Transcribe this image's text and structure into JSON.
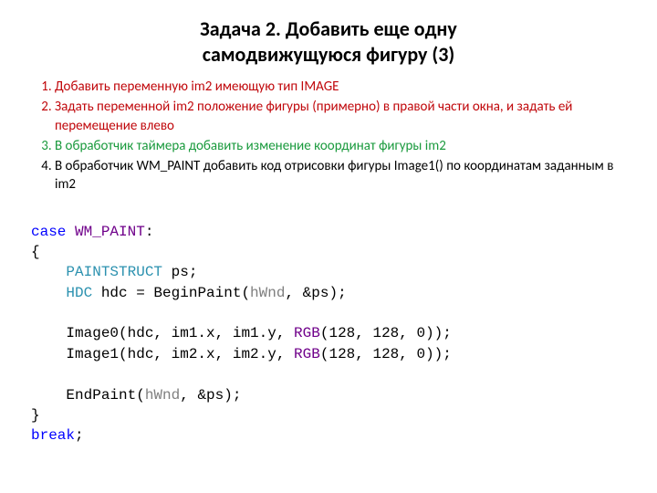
{
  "title_line1": "Задача 2.  Добавить еще одну",
  "title_line2": "самодвижущуюся фигуру (3)",
  "steps": [
    {
      "cls": "red",
      "text": "Добавить переменную im2 имеющую тип IMAGE"
    },
    {
      "cls": "red",
      "text": "Задать переменной im2 положение фигуры (примерно) в правой части окна, и задать ей перемещение влево"
    },
    {
      "cls": "green",
      "text": "В обработчик таймера добавить изменение координат фигуры  im2"
    },
    {
      "cls": "black",
      "text": "В обработчик WM_PAINT добавить код отрисовки фигуры Image1() по координатам заданным в im2"
    }
  ],
  "code": {
    "case_kw": "case",
    "wm_paint": "WM_PAINT",
    "colon": ":",
    "lbrace": "{",
    "paintstruct": "PAINTSTRUCT",
    "ps_decl": " ps;",
    "hdc_type": "HDC",
    "hdc_assign": " hdc = BeginPaint(",
    "hwnd": "hWnd",
    "amp_ps": ", &ps);",
    "img0_pre": "Image0(hdc, im1.x, im1.y, ",
    "rgb": "RGB",
    "rgb_args1": "(128, 128, 0));",
    "img1_pre": "Image1(hdc, im2.x, im2.y, ",
    "rgb_args2": "(128, 128, 0));",
    "endpaint_pre": "EndPaint(",
    "break_kw": "break",
    "rbrace": "}",
    "semi": ";"
  }
}
